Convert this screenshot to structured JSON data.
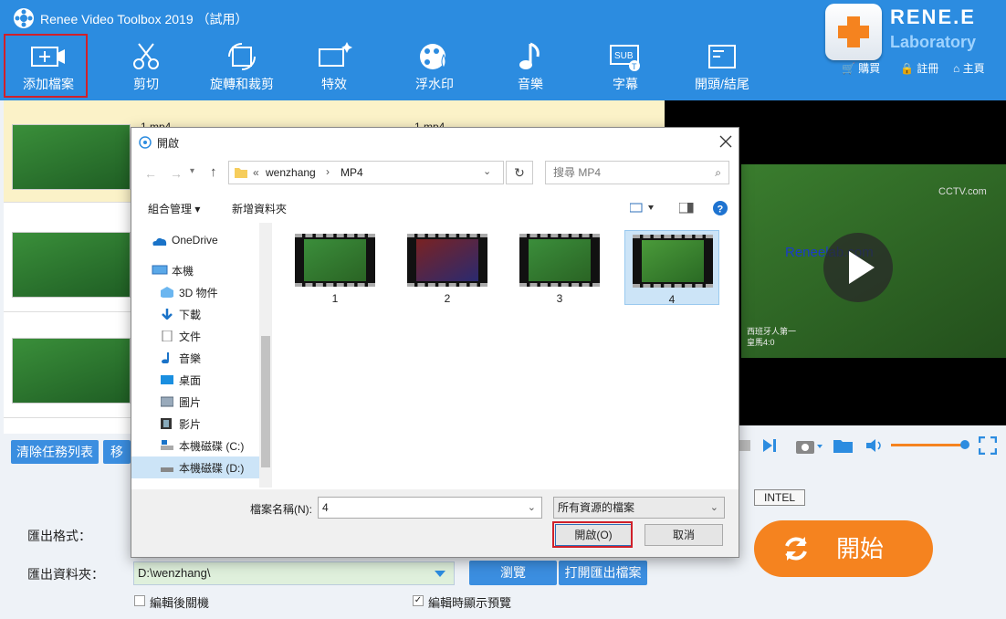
{
  "app": {
    "title": "Renee Video Toolbox 2019 （試用）"
  },
  "toolbar": [
    {
      "label": "添加檔案",
      "icon": "add-file-icon"
    },
    {
      "label": "剪切",
      "icon": "scissors-icon"
    },
    {
      "label": "旋轉和裁剪",
      "icon": "crop-rotate-icon"
    },
    {
      "label": "特效",
      "icon": "effects-icon"
    },
    {
      "label": "浮水印",
      "icon": "watermark-icon"
    },
    {
      "label": "音樂",
      "icon": "music-icon"
    },
    {
      "label": "字幕",
      "icon": "subtitle-icon"
    },
    {
      "label": "開頭/結尾",
      "icon": "intro-outro-icon"
    }
  ],
  "branding": {
    "line1": "RENE.E",
    "line2": "Laboratory"
  },
  "top_links": {
    "buy": "購買",
    "register": "註冊",
    "home": "主頁"
  },
  "file_list": {
    "row1_label": "1.mp4",
    "row1_label_b": "1.mp4"
  },
  "preview": {
    "channel": "CCTV.com",
    "watermark": "Reneelab.com",
    "caption_line1": "西班牙人第一",
    "caption_line2": "皇馬4:0"
  },
  "actions": {
    "clear_tasks": "清除任務列表",
    "move": "移"
  },
  "export": {
    "format_label": "匯出格式：",
    "folder_label": "匯出資料夾：",
    "folder_value": "D:\\wenzhang\\",
    "browse": "瀏覽",
    "open_folder": "打開匯出檔案",
    "shutdown_label": "編輯後關機",
    "preview_label": "編輯時顯示預覽",
    "gpu_label": "INTEL",
    "start": "開始"
  },
  "dialog": {
    "title": "開啟",
    "breadcrumb": [
      "wenzhang",
      "MP4"
    ],
    "breadcrumb_prefix": "«",
    "search_placeholder": "搜尋 MP4",
    "organize": "組合管理",
    "new_folder": "新增資料夾",
    "nav": [
      "OneDrive",
      "本機",
      "3D 物件",
      "下載",
      "文件",
      "音樂",
      "桌面",
      "圖片",
      "影片",
      "本機磁碟 (C:)",
      "本機磁碟 (D:)"
    ],
    "files": [
      "1",
      "2",
      "3",
      "4"
    ],
    "filename_label": "檔案名稱(N):",
    "filename_value": "4",
    "filetype_value": "所有資源的檔案",
    "open_button": "開啟(O)",
    "cancel_button": "取消"
  },
  "colors": {
    "topbar": "#2c8ce0",
    "accent": "#3b8ee0",
    "start": "#f5831f",
    "highlight": "#d0202a"
  }
}
